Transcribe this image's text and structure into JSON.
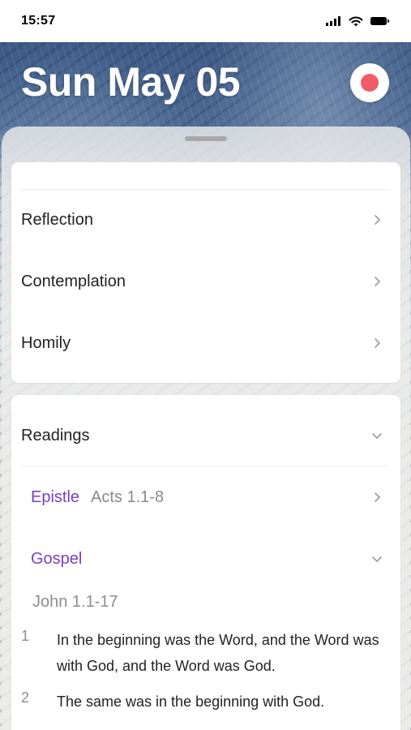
{
  "status_bar": {
    "time": "15:57"
  },
  "header": {
    "date_title": "Sun May 05"
  },
  "sections": [
    {
      "label": "Reflection"
    },
    {
      "label": "Contemplation"
    },
    {
      "label": "Homily"
    }
  ],
  "readings": {
    "label": "Readings",
    "epistle": {
      "title": "Epistle",
      "reference": "Acts 1.1-8"
    },
    "gospel": {
      "title": "Gospel",
      "reference": "John 1.1-17"
    },
    "verses": [
      {
        "num": "1",
        "text": "In the beginning was the Word, and the Word was with God, and the Word was God."
      },
      {
        "num": "2",
        "text": "The same was in the beginning with God."
      }
    ]
  },
  "colors": {
    "accent_purple": "#7a3fc4",
    "record_red": "#ef5c66",
    "header_blue": "#3c5a86"
  },
  "icons": {
    "record": "record-dot-icon",
    "signal": "cellular-signal-icon",
    "wifi": "wifi-icon",
    "battery": "battery-icon",
    "chevron_right": "chevron-right-icon",
    "chevron_down": "chevron-down-icon"
  }
}
